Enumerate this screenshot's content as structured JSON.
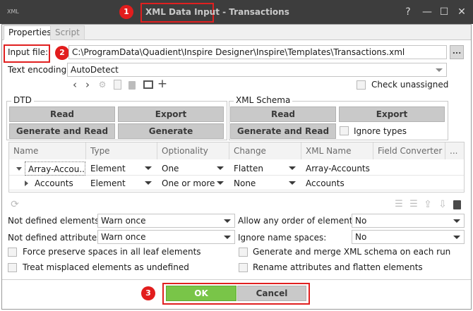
{
  "window": {
    "app_logo": "XML",
    "title_highlight": "XML Data Input",
    "title_rest": " - Transactions",
    "controls": [
      "?",
      "—",
      "☐",
      "✕"
    ]
  },
  "annotations": [
    "1",
    "2",
    "3"
  ],
  "tabs": [
    {
      "label": "Properties",
      "active": true
    },
    {
      "label": "Script",
      "active": false
    }
  ],
  "input_file": {
    "label": "Input file:",
    "value": "C:\\ProgramData\\Quadient\\Inspire Designer\\Inspire\\Templates\\Transactions.xml",
    "browse_label": "..."
  },
  "text_encoding": {
    "label": "Text encoding:",
    "value": "AutoDetect"
  },
  "toolbar_icons": [
    "chevron-left-icon",
    "chevron-right-icon",
    "settings-icon",
    "copy-icon",
    "trash-icon",
    "import-icon",
    "add-icon"
  ],
  "check_unassigned": {
    "label": "Check unassigned",
    "checked": false
  },
  "dtd": {
    "legend": "DTD",
    "read": "Read",
    "export": "Export",
    "generate_and_read": "Generate and Read",
    "generate": "Generate"
  },
  "xml_schema": {
    "legend": "XML Schema",
    "read": "Read",
    "export": "Export",
    "generate_and_read": "Generate and Read",
    "ignore_types": "Ignore types",
    "ignore_types_checked": false
  },
  "table": {
    "columns": [
      "Name",
      "Type",
      "Optionality",
      "Change",
      "XML Name",
      "Field Converter",
      "..."
    ],
    "rows": [
      {
        "name": "Array-Accou...",
        "type": "Element",
        "optionality": "One",
        "change": "Flatten",
        "xml_name": "Array-Accounts",
        "expanded": true
      },
      {
        "name": "Accounts",
        "type": "Element",
        "optionality": "One or more",
        "change": "None",
        "xml_name": "Accounts",
        "expanded": false
      }
    ]
  },
  "options": {
    "not_defined_elements": {
      "label": "Not defined elements:",
      "value": "Warn once"
    },
    "not_defined_attributes": {
      "label": "Not defined attributes:",
      "value": "Warn once"
    },
    "allow_any_order": {
      "label": "Allow any order of elements:",
      "value": "No"
    },
    "ignore_name_spaces": {
      "label": "Ignore name spaces:",
      "value": "No"
    },
    "force_preserve": "Force preserve spaces in all leaf elements",
    "treat_misplaced": "Treat misplaced elements as undefined",
    "generate_merge": "Generate and merge XML schema on each run",
    "rename_attributes": "Rename attributes and flatten elements"
  },
  "footer": {
    "ok": "OK",
    "cancel": "Cancel"
  },
  "colors": {
    "titlebar": "#3d3d3d",
    "highlight": "#e02020",
    "ok_green": "#79c548",
    "button_gray": "#c9c9c9"
  }
}
